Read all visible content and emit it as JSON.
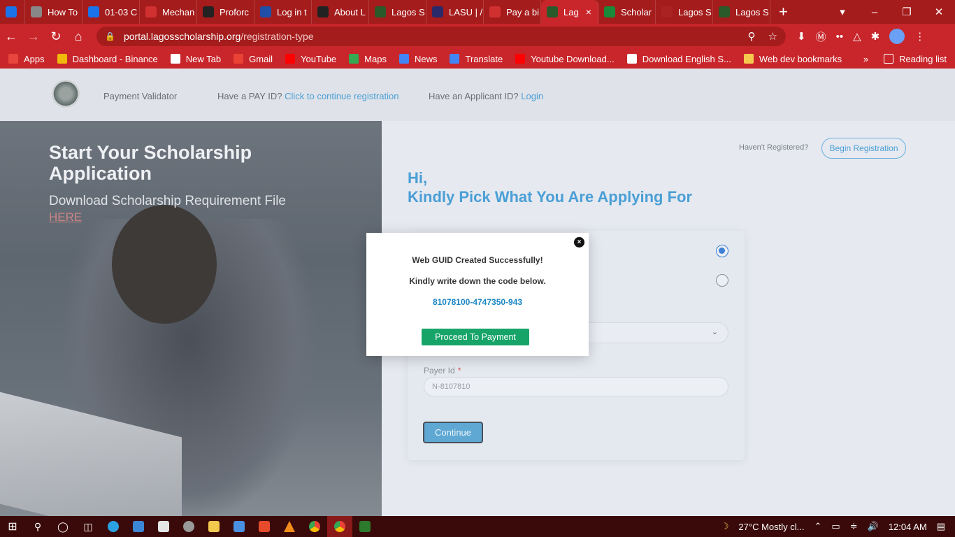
{
  "browser": {
    "tabs": [
      {
        "label": "",
        "icon": "c-logo-icon",
        "color": "#1a73e8"
      },
      {
        "label": "How To",
        "icon": "image-icon",
        "color": "#888888"
      },
      {
        "label": "01-03 C",
        "icon": "c-logo-icon",
        "color": "#1a73e8"
      },
      {
        "label": "Mechan",
        "icon": "bl-icon",
        "color": "#d03030"
      },
      {
        "label": "Proforc",
        "icon": "proforce-icon",
        "color": "#222222"
      },
      {
        "label": "Log in t",
        "icon": "paypal-icon",
        "color": "#1f4fa8"
      },
      {
        "label": "About L",
        "icon": "about-icon",
        "color": "#222222"
      },
      {
        "label": "Lagos S",
        "icon": "lagos-icon",
        "color": "#2a5a2a"
      },
      {
        "label": "LASU | /",
        "icon": "lasu-icon",
        "color": "#2a2a6a"
      },
      {
        "label": "Pay a bi",
        "icon": "dots-icon",
        "color": "#d03030"
      },
      {
        "label": "Lag",
        "icon": "lagos-icon",
        "color": "#2a5a2a",
        "active": true
      },
      {
        "label": "Scholar",
        "icon": "scholar-icon",
        "color": "#1a8a3a"
      },
      {
        "label": "Lagos S",
        "icon": "crest-icon",
        "color": "#aa2222"
      },
      {
        "label": "Lagos S",
        "icon": "lagos-icon",
        "color": "#2a5a2a"
      }
    ],
    "new_tab": "+",
    "url_host": "portal.lagosscholarship.org",
    "url_path": "/registration-type",
    "bookmarks": [
      {
        "label": "Apps",
        "color": "#e8453c"
      },
      {
        "label": "Dashboard - Binance",
        "color": "#f0b90b"
      },
      {
        "label": "New Tab",
        "color": "#ffffff"
      },
      {
        "label": "Gmail",
        "color": "#ea4335"
      },
      {
        "label": "YouTube",
        "color": "#ff0000"
      },
      {
        "label": "Maps",
        "color": "#34a853"
      },
      {
        "label": "News",
        "color": "#4285f4"
      },
      {
        "label": "Translate",
        "color": "#4285f4"
      },
      {
        "label": "Youtube Download...",
        "color": "#ff0000"
      },
      {
        "label": "Download English S...",
        "color": "#ffffff"
      },
      {
        "label": "Web dev bookmarks",
        "color": "#f6c94e"
      }
    ],
    "bookmarks_more": "»",
    "reading_list": "Reading list"
  },
  "site": {
    "nav": {
      "payment_validator": "Payment Validator",
      "pay_id_prefix": "Have a PAY ID?",
      "pay_id_link": "Click to continue registration",
      "applicant_prefix": "Have an Applicant ID?",
      "applicant_link": "Login"
    },
    "hero": {
      "title": "Start Your Scholarship Application",
      "download_text": "Download Scholarship Requirement File",
      "here_link": "HERE"
    },
    "form": {
      "havent_registered": "Haven't Registered?",
      "begin_registration": "Begin Registration",
      "greeting_line1": "Hi,",
      "greeting_line2": "Kindly Pick What You Are Applying For",
      "payer_label": "Payer Id",
      "payer_required": "*",
      "payer_value": "N-8107810",
      "continue_label": "Continue",
      "selected_option": 1
    },
    "modal": {
      "line1": "Web GUID Created Successfully!",
      "line2": "Kindly write down the code below.",
      "code": "81078100-4747350-943",
      "button": "Proceed To Payment"
    }
  },
  "taskbar": {
    "weather": "27°C  Mostly cl...",
    "time": "12:04 AM"
  }
}
